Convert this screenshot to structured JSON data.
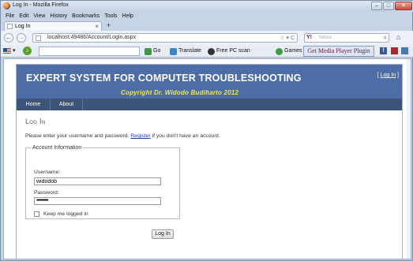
{
  "window": {
    "title": "Log In - Mozilla Firefox"
  },
  "menubar": [
    "File",
    "Edit",
    "View",
    "History",
    "Bookmarks",
    "Tools",
    "Help"
  ],
  "tab": {
    "label": "Log In",
    "close": "×",
    "new_tab": "+"
  },
  "nav": {
    "back": "←",
    "forward": "→",
    "url": "localhost:49486/Account/Login.aspx",
    "url_controls": "☆ ▾ C",
    "search_engine": "Y!",
    "search_placeholder": "Yahoo",
    "search_go": "⌕",
    "home": "⌂"
  },
  "toolbar": {
    "go": "Go",
    "translate": "Translate",
    "free_pc_scan": "Free PC scan",
    "games": "Games",
    "media_plugin": "Get Media Player Plugin",
    "facebook": "f",
    "flag_arrow": "▾"
  },
  "site": {
    "title": "EXPERT SYSTEM FOR  COMPUTER TROUBLESHOOTING",
    "copyright": "Copyright Dr. Widodo Budiharto 2012",
    "login_bracket_open": "[",
    "login_link": "Log In",
    "login_bracket_close": "]",
    "menu": [
      "Home",
      "About"
    ]
  },
  "login": {
    "heading": "Log In",
    "intro_before": "Please enter your username and password.",
    "register_link": "Register",
    "intro_after": "if you don't have an account.",
    "legend": "Account Information",
    "username_label": "Username:",
    "username_value": "widodob",
    "password_label": "Password:",
    "password_value": "••••••••••",
    "remember_label": "Keep me logged in",
    "remember_checked": false,
    "submit_label": "Log In"
  },
  "colors": {
    "header": "#4d6da7",
    "menu": "#3b5478",
    "copyright": "#f3e84b"
  }
}
